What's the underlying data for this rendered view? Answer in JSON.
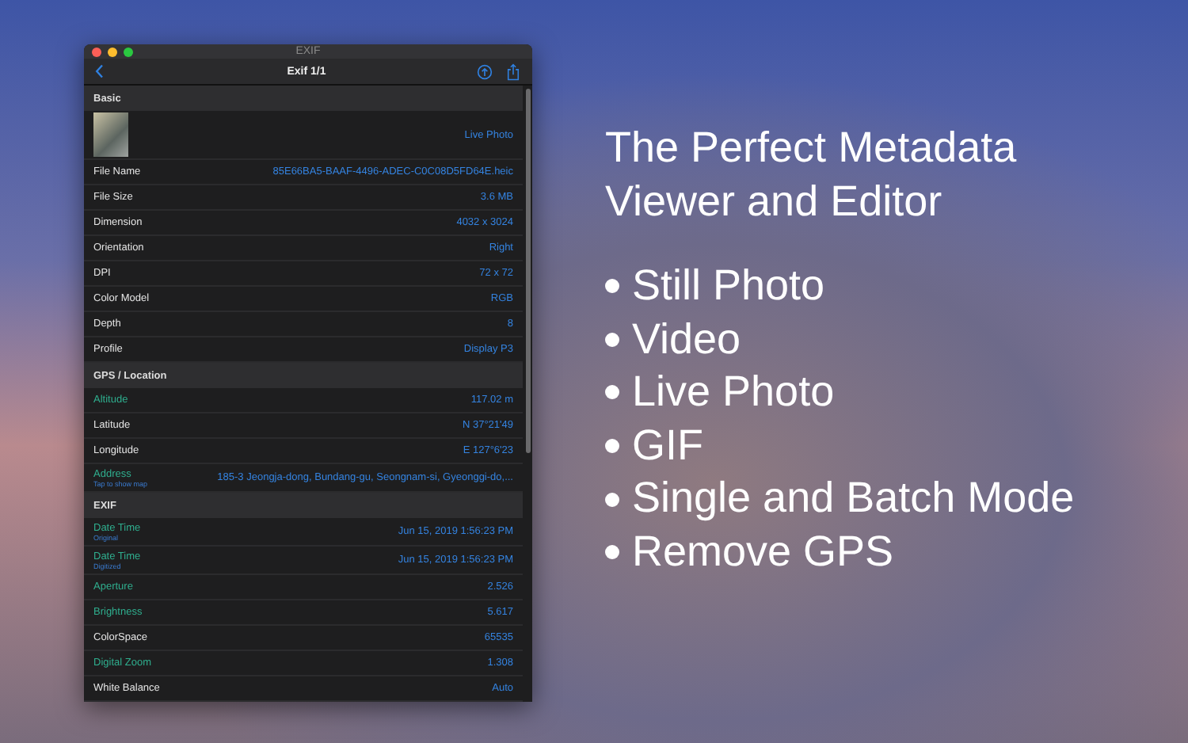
{
  "window": {
    "title": "EXIF",
    "toolbar_title": "Exif 1/1"
  },
  "sections": [
    {
      "title": "Basic",
      "rows": [
        {
          "kind": "photo",
          "value": "Live Photo"
        },
        {
          "kind": "field",
          "label": "File Name",
          "color": "#e4e4e4",
          "value": "85E66BA5-BAAF-4496-ADEC-C0C08D5FD64E.heic"
        },
        {
          "kind": "field",
          "label": "File Size",
          "color": "#e4e4e4",
          "value": "3.6 MB"
        },
        {
          "kind": "field",
          "label": "Dimension",
          "color": "#e4e4e4",
          "value": "4032 x 3024"
        },
        {
          "kind": "field",
          "label": "Orientation",
          "color": "#e4e4e4",
          "value": "Right"
        },
        {
          "kind": "field",
          "label": "DPI",
          "color": "#e4e4e4",
          "value": "72 x 72"
        },
        {
          "kind": "field",
          "label": "Color Model",
          "color": "#e4e4e4",
          "value": "RGB"
        },
        {
          "kind": "field",
          "label": "Depth",
          "color": "#e4e4e4",
          "value": "8"
        },
        {
          "kind": "field",
          "label": "Profile",
          "color": "#e4e4e4",
          "value": "Display P3"
        }
      ]
    },
    {
      "title": "GPS / Location",
      "rows": [
        {
          "kind": "field",
          "label": "Altitude",
          "color": "#2fae8e",
          "value": "117.02 m"
        },
        {
          "kind": "field",
          "label": "Latitude",
          "color": "#e4e4e4",
          "value": "N 37°21'49"
        },
        {
          "kind": "field",
          "label": "Longitude",
          "color": "#e4e4e4",
          "value": "E 127°6'23"
        },
        {
          "kind": "field",
          "label": "Address",
          "sublabel": "Tap to show map",
          "color": "#2fae8e",
          "value": "185-3 Jeongja-dong, Bundang-gu, Seongnam-si, Gyeonggi-do,..."
        }
      ]
    },
    {
      "title": "EXIF",
      "rows": [
        {
          "kind": "field",
          "label": "Date Time",
          "sublabel": "Original",
          "color": "#2fae8e",
          "value": "Jun 15, 2019 1:56:23 PM"
        },
        {
          "kind": "field",
          "label": "Date Time",
          "sublabel": "Digitized",
          "color": "#2fae8e",
          "value": "Jun 15, 2019 1:56:23 PM"
        },
        {
          "kind": "field",
          "label": "Aperture",
          "color": "#2fae8e",
          "value": "2.526"
        },
        {
          "kind": "field",
          "label": "Brightness",
          "color": "#2fae8e",
          "value": "5.617"
        },
        {
          "kind": "field",
          "label": "ColorSpace",
          "color": "#e4e4e4",
          "value": "65535"
        },
        {
          "kind": "field",
          "label": "Digital Zoom",
          "color": "#2fae8e",
          "value": "1.308"
        },
        {
          "kind": "field",
          "label": "White Balance",
          "color": "#e4e4e4",
          "value": "Auto"
        }
      ]
    }
  ],
  "headline": [
    "The Perfect Metadata",
    "Viewer and Editor"
  ],
  "features": [
    "Still Photo",
    "Video",
    "Live Photo",
    "GIF",
    "Single and Batch Mode",
    "Remove GPS"
  ]
}
